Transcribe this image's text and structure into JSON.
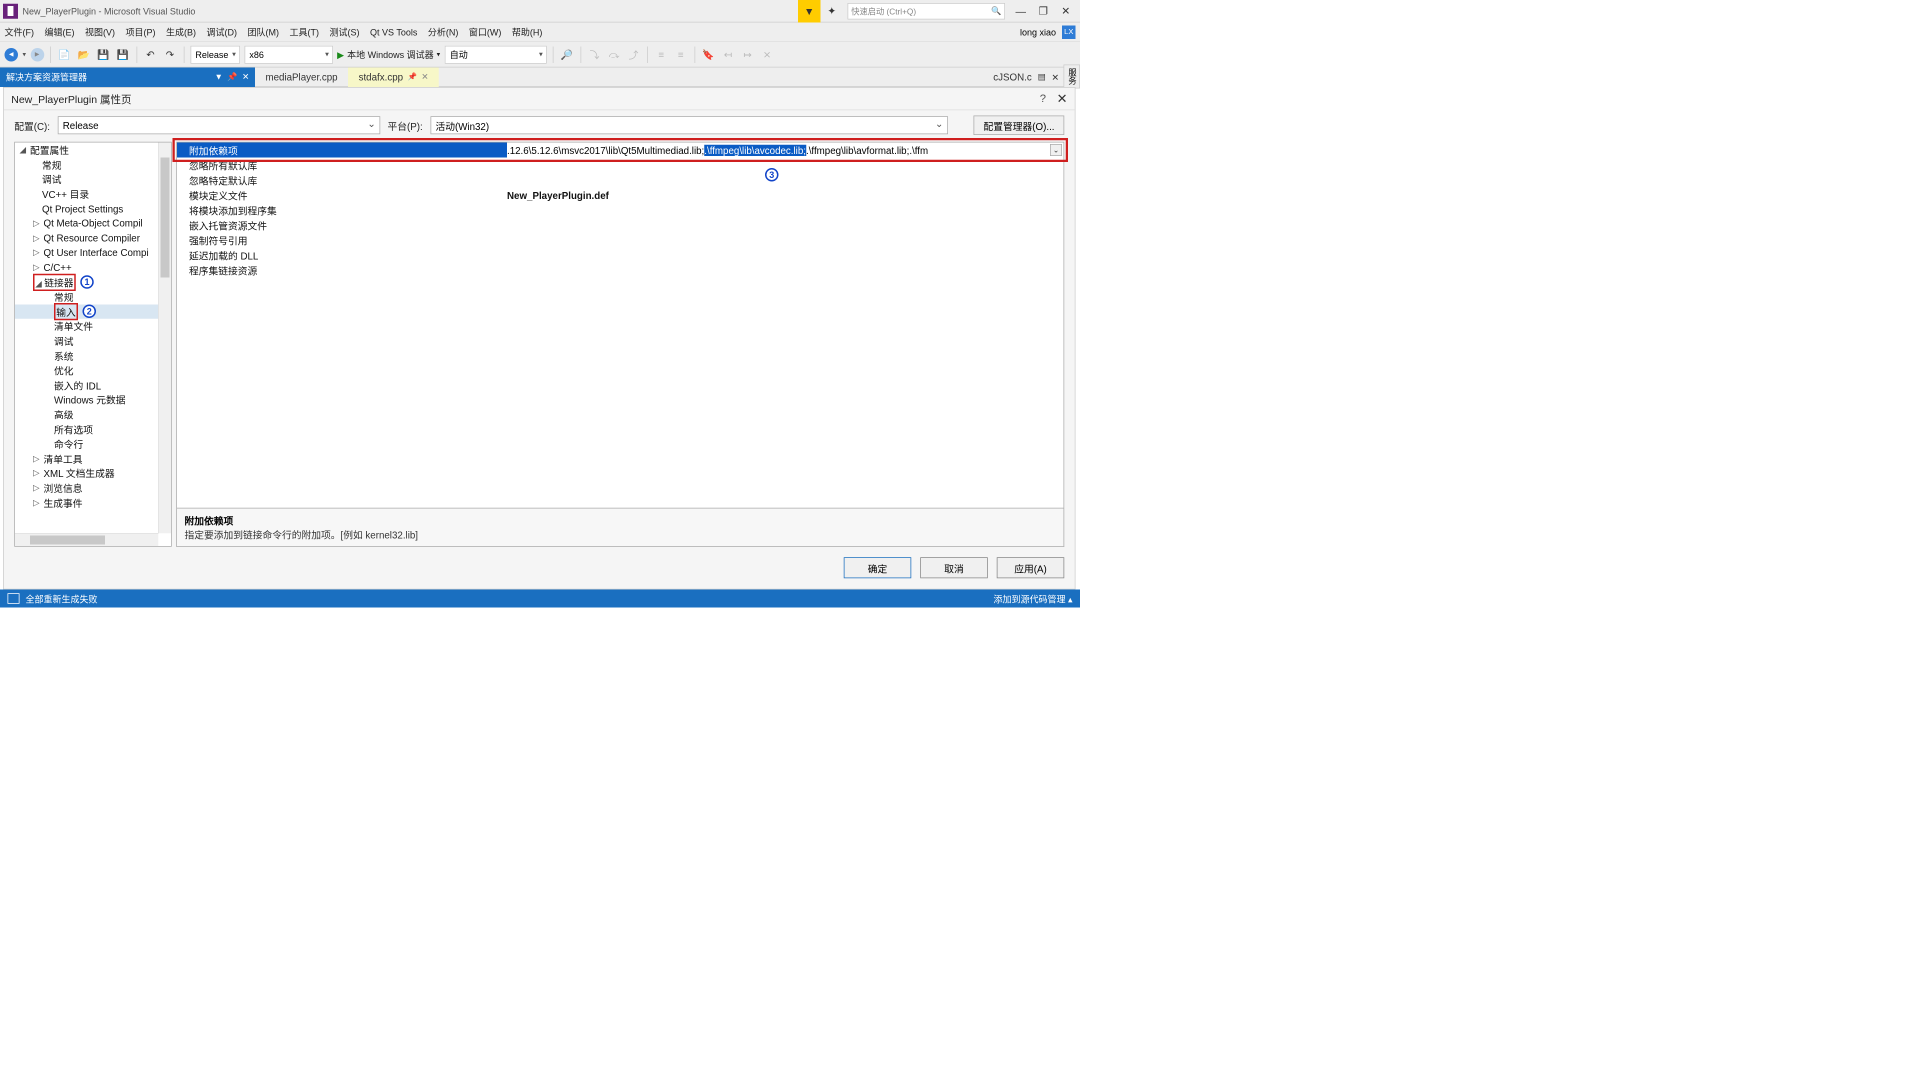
{
  "title": "New_PlayerPlugin - Microsoft Visual Studio",
  "quick_launch_placeholder": "快速启动 (Ctrl+Q)",
  "menus": [
    "文件(F)",
    "编辑(E)",
    "视图(V)",
    "项目(P)",
    "生成(B)",
    "调试(D)",
    "团队(M)",
    "工具(T)",
    "测试(S)",
    "Qt VS Tools",
    "分析(N)",
    "窗口(W)",
    "帮助(H)"
  ],
  "user_name": "long xiao",
  "user_initials": "LX",
  "toolbar": {
    "config_combo": "Release",
    "platform_combo": "x86",
    "debug_target": "本地 Windows 调试器",
    "auto_combo": "自动"
  },
  "solution_explorer_tab": "解决方案资源管理器",
  "doc_tabs": {
    "t1": "mediaPlayer.cpp",
    "t2": "stdafx.cpp",
    "right": "cJSON.c"
  },
  "side_tab": "服务",
  "prop_page_title": "New_PlayerPlugin 属性页",
  "config_row": {
    "config_label": "配置(C):",
    "config_value": "Release",
    "platform_label": "平台(P):",
    "platform_value": "活动(Win32)",
    "manager_btn": "配置管理器(O)..."
  },
  "tree": {
    "root": "配置属性",
    "n1": "常规",
    "n2": "调试",
    "n3": "VC++ 目录",
    "n4": "Qt Project Settings",
    "n5": "Qt Meta-Object Compil",
    "n6": "Qt Resource Compiler",
    "n7": "Qt User Interface Compi",
    "n8": "C/C++",
    "n9": "链接器",
    "n9a": "常规",
    "n9b": "输入",
    "n9c": "清单文件",
    "n9d": "调试",
    "n9e": "系统",
    "n9f": "优化",
    "n9g": "嵌入的 IDL",
    "n9h": "Windows 元数据",
    "n9i": "高级",
    "n9j": "所有选项",
    "n9k": "命令行",
    "n10": "清单工具",
    "n11": "XML 文档生成器",
    "n12": "浏览信息",
    "n13": "生成事件"
  },
  "grid": {
    "r1k": "附加依赖项",
    "r1v_pre": ".12.6\\5.12.6\\msvc2017\\lib\\Qt5Multimediad.lib;",
    "r1v_hl": ".\\ffmpeg\\lib\\avcodec.lib;",
    "r1v_post": ".\\ffmpeg\\lib\\avformat.lib;.\\ffm",
    "r2k": "忽略所有默认库",
    "r3k": "忽略特定默认库",
    "r4k": "模块定义文件",
    "r4v": "New_PlayerPlugin.def",
    "r5k": "将模块添加到程序集",
    "r6k": "嵌入托管资源文件",
    "r7k": "强制符号引用",
    "r8k": "延迟加载的 DLL",
    "r9k": "程序集链接资源"
  },
  "desc": {
    "title": "附加依赖项",
    "body": "指定要添加到链接命令行的附加项。[例如 kernel32.lib]"
  },
  "buttons": {
    "ok": "确定",
    "cancel": "取消",
    "apply": "应用(A)"
  },
  "status": {
    "text": "全部重新生成失败",
    "right": "添加到源代码管理 ▴"
  },
  "badges": {
    "b1": "1",
    "b2": "2",
    "b3": "3"
  }
}
